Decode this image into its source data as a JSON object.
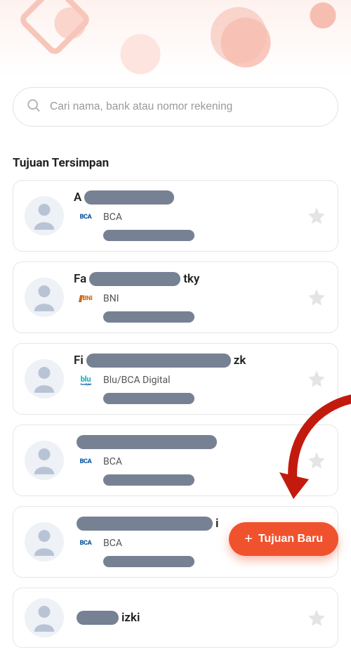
{
  "search": {
    "placeholder": "Cari nama, bank atau nomor rekening"
  },
  "section_title": "Tujuan Tersimpan",
  "contacts": [
    {
      "name_pre": "A",
      "name_post": "",
      "redact_w": 128,
      "bank_code": "BCA",
      "bank_label": "BCA",
      "logo_class": "bca"
    },
    {
      "name_pre": "Fa",
      "name_post": "tky",
      "redact_w": 130,
      "bank_code": "BNI",
      "bank_label": "BNI",
      "logo_class": "bni"
    },
    {
      "name_pre": "Fi",
      "name_post": "zk",
      "redact_w": 206,
      "bank_code": "blu",
      "bank_label": "Blu/BCA Digital",
      "logo_class": "blu"
    },
    {
      "name_pre": "",
      "name_post": "",
      "redact_w": 200,
      "bank_code": "BCA",
      "bank_label": "BCA",
      "logo_class": "bca"
    },
    {
      "name_pre": "",
      "name_post": "i",
      "redact_w": 194,
      "bank_code": "BCA",
      "bank_label": "BCA",
      "logo_class": "bca"
    },
    {
      "name_pre": "",
      "name_post": "izki",
      "redact_w": 60,
      "bank_code": "",
      "bank_label": "",
      "logo_class": ""
    }
  ],
  "fab_label": "Tujuan Baru",
  "colors": {
    "accent": "#f0522e"
  }
}
